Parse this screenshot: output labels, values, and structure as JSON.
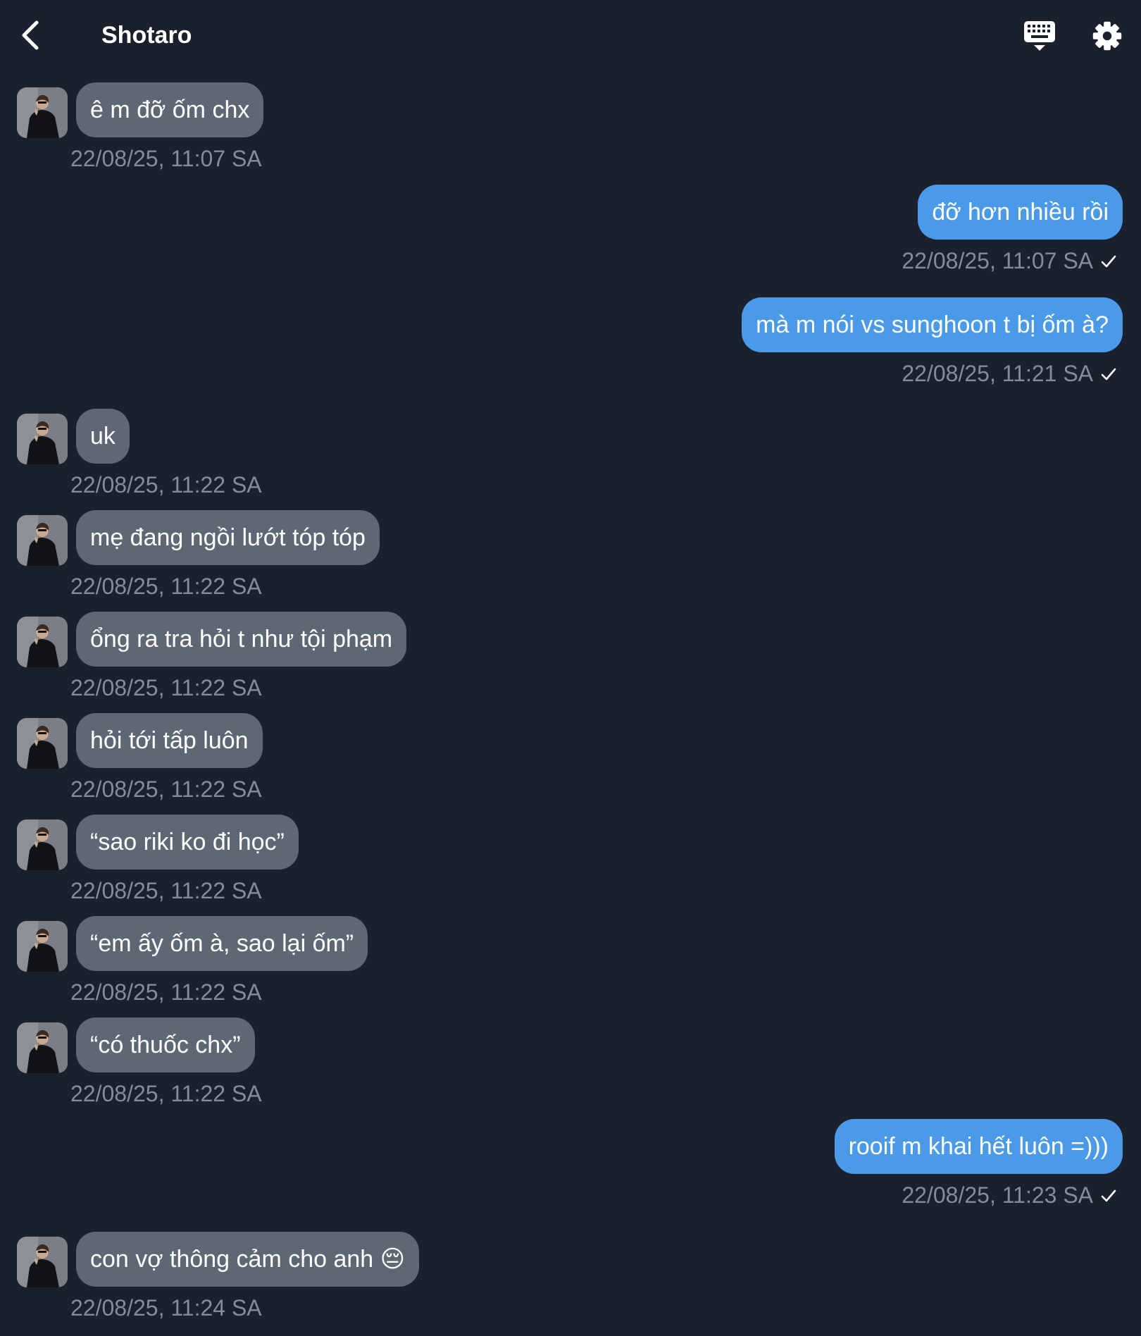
{
  "header": {
    "title": "Shotaro",
    "back_icon": "chevron-left-icon",
    "keyboard_icon": "keyboard-icon",
    "settings_icon": "gear-icon"
  },
  "colors": {
    "background": "#1a212c",
    "incoming_bubble": "#5e6875",
    "outgoing_bubble": "#4a9ae8",
    "timestamp": "#858c97"
  },
  "messages": [
    {
      "dir": "in",
      "text": "ê m đỡ ốm chx",
      "time": "22/08/25, 11:07 SA"
    },
    {
      "dir": "out",
      "text": "đỡ hơn nhiều rồi",
      "time": "22/08/25, 11:07 SA"
    },
    {
      "dir": "out",
      "text": "mà m nói vs sunghoon t bị ốm à?",
      "time": "22/08/25, 11:21 SA"
    },
    {
      "dir": "in",
      "text": "uk",
      "time": "22/08/25, 11:22 SA"
    },
    {
      "dir": "in",
      "text": "mẹ đang ngồi lướt tóp tóp",
      "time": "22/08/25, 11:22 SA"
    },
    {
      "dir": "in",
      "text": "ổng ra tra hỏi t như tội phạm",
      "time": "22/08/25, 11:22 SA"
    },
    {
      "dir": "in",
      "text": "hỏi tới tấp luôn",
      "time": "22/08/25, 11:22 SA"
    },
    {
      "dir": "in",
      "text": "“sao riki ko đi học”",
      "time": "22/08/25, 11:22 SA"
    },
    {
      "dir": "in",
      "text": "“em ấy ốm à, sao lại ốm”",
      "time": "22/08/25, 11:22 SA"
    },
    {
      "dir": "in",
      "text": "“có thuốc chx”",
      "time": "22/08/25, 11:22 SA"
    },
    {
      "dir": "out",
      "text": "rooif m khai hết luôn =)))",
      "time": "22/08/25, 11:23 SA"
    },
    {
      "dir": "in",
      "text": "con vợ thông cảm cho anh 😔",
      "time": "22/08/25, 11:24 SA"
    }
  ]
}
